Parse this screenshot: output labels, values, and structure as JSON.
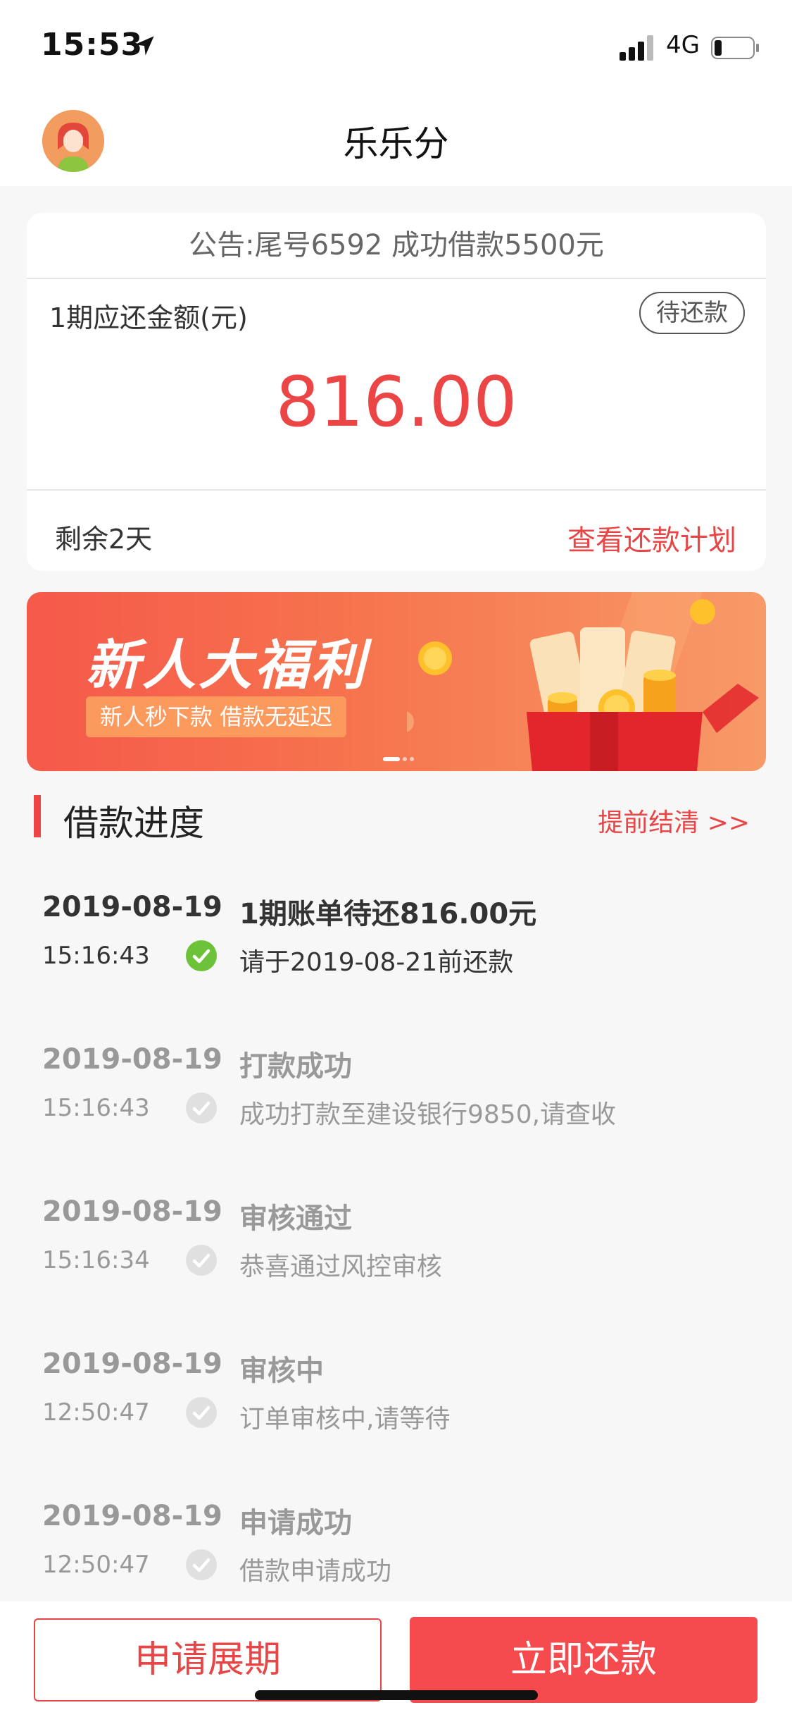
{
  "status_bar": {
    "time": "15:53",
    "network": "4G"
  },
  "header": {
    "title": "乐乐分"
  },
  "bill": {
    "notice": "公告:尾号6592 成功借款5500元",
    "amount_label": "1期应还金额(元)",
    "status": "待还款",
    "amount": "816.00",
    "remaining": "剩余2天",
    "plan_link": "查看还款计划"
  },
  "banner": {
    "title": "新人大福利",
    "subtitle": "新人秒下款 借款无延迟"
  },
  "progress": {
    "title": "借款进度",
    "prepay_link": "提前结清   >>",
    "items": [
      {
        "date": "2019-08-19",
        "time": "15:16:43",
        "title": "1期账单待还816.00元",
        "desc": "请于2019-08-21前还款",
        "state": "active"
      },
      {
        "date": "2019-08-19",
        "time": "15:16:43",
        "title": "打款成功",
        "desc": "成功打款至建设银行9850,请查收",
        "state": "done"
      },
      {
        "date": "2019-08-19",
        "time": "15:16:34",
        "title": "审核通过",
        "desc": "恭喜通过风控审核",
        "state": "done"
      },
      {
        "date": "2019-08-19",
        "time": "12:50:47",
        "title": "审核中",
        "desc": "订单审核中,请等待",
        "state": "done"
      },
      {
        "date": "2019-08-19",
        "time": "12:50:47",
        "title": "申请成功",
        "desc": "借款申请成功",
        "state": "done"
      }
    ]
  },
  "actions": {
    "extend": "申请展期",
    "repay": "立即还款"
  },
  "colors": {
    "accent": "#ec4545",
    "success": "#6cc33a",
    "button": "#f54b4f"
  }
}
